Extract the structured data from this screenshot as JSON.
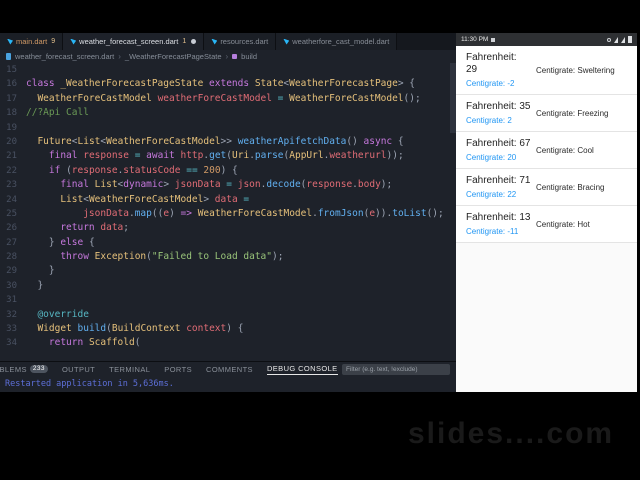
{
  "window": {
    "watermark": "slides....com"
  },
  "colors": {
    "accent_blue": "#2196F3",
    "console_text": "#5d6fd8",
    "tab_modified": "#d19a66",
    "comment_green": "#6a9955"
  },
  "editor_tabs": [
    {
      "label": "main.dart",
      "badge": "9",
      "label_color": "#d19a66"
    },
    {
      "label": "weather_forecast_screen.dart",
      "badge": "1",
      "dirty": true,
      "active": true,
      "label_color": "#dcdfe4"
    },
    {
      "label": "resources.dart",
      "label_color": "#878d96"
    },
    {
      "label": "weatherfore_cast_model.dart",
      "label_color": "#878d96"
    }
  ],
  "breadcrumb": {
    "file": "weather_forecast_screen.dart",
    "symbol": "_WeatherForecastPageState",
    "member": "build"
  },
  "editor": {
    "lines": [
      {
        "n": 15,
        "tk": []
      },
      {
        "n": 16,
        "tk": [
          [
            "class ",
            "k"
          ],
          [
            "_WeatherForecastPageState ",
            "t"
          ],
          [
            "extends ",
            "k"
          ],
          [
            "State",
            "t"
          ],
          [
            "<",
            "p"
          ],
          [
            "WeatherForecastPage",
            "t"
          ],
          [
            ">",
            "p"
          ],
          [
            " {",
            "p"
          ]
        ]
      },
      {
        "n": 17,
        "tk": [
          [
            "  ",
            "p"
          ],
          [
            "WeatherForeCastModel ",
            "t"
          ],
          [
            "weatherForeCastModel ",
            "v"
          ],
          [
            "= ",
            "o"
          ],
          [
            "WeatherForeCastModel",
            "t"
          ],
          [
            "();",
            "p"
          ]
        ]
      },
      {
        "n": 18,
        "tk": [
          [
            "//?Api Call",
            "c"
          ]
        ]
      },
      {
        "n": 19,
        "tk": []
      },
      {
        "n": 20,
        "tk": [
          [
            "  ",
            "p"
          ],
          [
            "Future",
            "t"
          ],
          [
            "<",
            "p"
          ],
          [
            "List",
            "t"
          ],
          [
            "<",
            "p"
          ],
          [
            "WeatherForeCastModel",
            "t"
          ],
          [
            ">> ",
            "p"
          ],
          [
            "weatherApifetchData",
            "f"
          ],
          [
            "() ",
            "p"
          ],
          [
            "async ",
            "k"
          ],
          [
            "{",
            "p"
          ]
        ]
      },
      {
        "n": 21,
        "tk": [
          [
            "    ",
            "p"
          ],
          [
            "final ",
            "k"
          ],
          [
            "response ",
            "v"
          ],
          [
            "= ",
            "o"
          ],
          [
            "await ",
            "k"
          ],
          [
            "http",
            "v"
          ],
          [
            ".",
            "p"
          ],
          [
            "get",
            "f"
          ],
          [
            "(",
            "p"
          ],
          [
            "Uri",
            "t"
          ],
          [
            ".",
            "p"
          ],
          [
            "parse",
            "f"
          ],
          [
            "(",
            "p"
          ],
          [
            "AppUrl",
            "t"
          ],
          [
            ".",
            "p"
          ],
          [
            "weatherurl",
            "v"
          ],
          [
            "));",
            "p"
          ]
        ]
      },
      {
        "n": 22,
        "tk": [
          [
            "    ",
            "p"
          ],
          [
            "if ",
            "k"
          ],
          [
            "(",
            "p"
          ],
          [
            "response",
            "v"
          ],
          [
            ".",
            "p"
          ],
          [
            "statusCode ",
            "v"
          ],
          [
            "== ",
            "o"
          ],
          [
            "200",
            "n"
          ],
          [
            ") {",
            "p"
          ]
        ]
      },
      {
        "n": 23,
        "tk": [
          [
            "      ",
            "p"
          ],
          [
            "final ",
            "k"
          ],
          [
            "List",
            "t"
          ],
          [
            "<",
            "p"
          ],
          [
            "dynamic",
            "k"
          ],
          [
            "> ",
            "p"
          ],
          [
            "jsonData ",
            "v"
          ],
          [
            "= ",
            "o"
          ],
          [
            "json",
            "v"
          ],
          [
            ".",
            "p"
          ],
          [
            "decode",
            "f"
          ],
          [
            "(",
            "p"
          ],
          [
            "response",
            "v"
          ],
          [
            ".",
            "p"
          ],
          [
            "body",
            "v"
          ],
          [
            ");",
            "p"
          ]
        ]
      },
      {
        "n": 24,
        "tk": [
          [
            "      ",
            "p"
          ],
          [
            "List",
            "t"
          ],
          [
            "<",
            "p"
          ],
          [
            "WeatherForeCastModel",
            "t"
          ],
          [
            "> ",
            "p"
          ],
          [
            "data ",
            "v"
          ],
          [
            "=",
            "o"
          ]
        ]
      },
      {
        "n": 25,
        "tk": [
          [
            "          ",
            "p"
          ],
          [
            "jsonData",
            "v"
          ],
          [
            ".",
            "p"
          ],
          [
            "map",
            "f"
          ],
          [
            "((",
            "p"
          ],
          [
            "e",
            "v"
          ],
          [
            ") ",
            "p"
          ],
          [
            "=> ",
            "k"
          ],
          [
            "WeatherForeCastModel",
            "t"
          ],
          [
            ".",
            "p"
          ],
          [
            "fromJson",
            "f"
          ],
          [
            "(",
            "p"
          ],
          [
            "e",
            "v"
          ],
          [
            "))",
            "p"
          ],
          [
            ".",
            "p"
          ],
          [
            "toList",
            "f"
          ],
          [
            "();",
            "p"
          ]
        ]
      },
      {
        "n": 26,
        "tk": [
          [
            "      ",
            "p"
          ],
          [
            "return ",
            "k"
          ],
          [
            "data",
            "v"
          ],
          [
            ";",
            "p"
          ]
        ]
      },
      {
        "n": 27,
        "tk": [
          [
            "    } ",
            "p"
          ],
          [
            "else ",
            "k"
          ],
          [
            "{",
            "p"
          ]
        ]
      },
      {
        "n": 28,
        "tk": [
          [
            "      ",
            "p"
          ],
          [
            "throw ",
            "k"
          ],
          [
            "Exception",
            "t"
          ],
          [
            "(",
            "p"
          ],
          [
            "\"Failed to Load data\"",
            "s"
          ],
          [
            ");",
            "p"
          ]
        ]
      },
      {
        "n": 29,
        "tk": [
          [
            "    }",
            "p"
          ]
        ]
      },
      {
        "n": 30,
        "tk": [
          [
            "  }",
            "p"
          ]
        ]
      },
      {
        "n": 31,
        "tk": []
      },
      {
        "n": 32,
        "tk": [
          [
            "  ",
            "p"
          ],
          [
            "@override",
            "a"
          ]
        ]
      },
      {
        "n": 33,
        "tk": [
          [
            "  ",
            "p"
          ],
          [
            "Widget ",
            "t"
          ],
          [
            "build",
            "f"
          ],
          [
            "(",
            "p"
          ],
          [
            "BuildContext ",
            "t"
          ],
          [
            "context",
            "v"
          ],
          [
            ") {",
            "p"
          ]
        ]
      },
      {
        "n": 34,
        "tk": [
          [
            "    ",
            "p"
          ],
          [
            "return ",
            "k"
          ],
          [
            "Scaffold",
            "t"
          ],
          [
            "(",
            "p"
          ]
        ]
      }
    ]
  },
  "panel": {
    "tabs": [
      {
        "label": "PROBLEMS",
        "badge": "233"
      },
      {
        "label": "OUTPUT"
      },
      {
        "label": "TERMINAL"
      },
      {
        "label": "PORTS"
      },
      {
        "label": "COMMENTS"
      },
      {
        "label": "DEBUG CONSOLE",
        "active": true
      }
    ],
    "filter_placeholder": "Filter (e.g. text, !exclude)",
    "console_line": "Restarted application in 5,636ms."
  },
  "emulator": {
    "status_time": "11:30 PM",
    "items": [
      {
        "title": "Fahrenheit: 29",
        "subtitle": "Centigrate: -2",
        "trailing": "Centigrate: Sweltering",
        "wrap": true
      },
      {
        "title": "Fahrenheit: 35",
        "subtitle": "Centigrate: 2",
        "trailing": "Centigrate: Freezing"
      },
      {
        "title": "Fahrenheit: 67",
        "subtitle": "Centigrate: 20",
        "trailing": "Centigrate: Cool"
      },
      {
        "title": "Fahrenheit: 71",
        "subtitle": "Centigrate: 22",
        "trailing": "Centigrate: Bracing"
      },
      {
        "title": "Fahrenheit: 13",
        "subtitle": "Centigrate: -11",
        "trailing": "Centigrate: Hot"
      }
    ]
  }
}
